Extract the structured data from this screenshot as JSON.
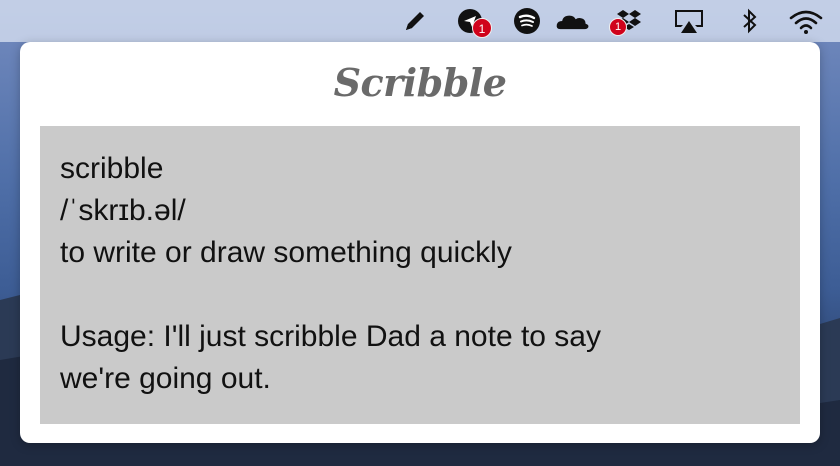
{
  "menubar": {
    "icons": [
      {
        "name": "pencil-icon"
      },
      {
        "name": "airmail-icon",
        "badge": "1"
      },
      {
        "name": "spotify-icon"
      },
      {
        "name": "onedrive-icon"
      },
      {
        "name": "dropbox-icon",
        "badge": "1"
      },
      {
        "name": "airplay-icon"
      },
      {
        "name": "bluetooth-icon"
      },
      {
        "name": "wifi-icon"
      }
    ],
    "badge_color": "#d0021b"
  },
  "popover": {
    "title": "Scribble",
    "word": "scribble",
    "pronunciation": "/ˈskrɪb.əl/",
    "definition": "to write or draw something quickly",
    "usage_line1": "Usage: I'll just scribble Dad a note to say",
    "usage_line2": "we're going out."
  },
  "colors": {
    "title": "#6a6a6a",
    "box_background": "#cacaca"
  }
}
